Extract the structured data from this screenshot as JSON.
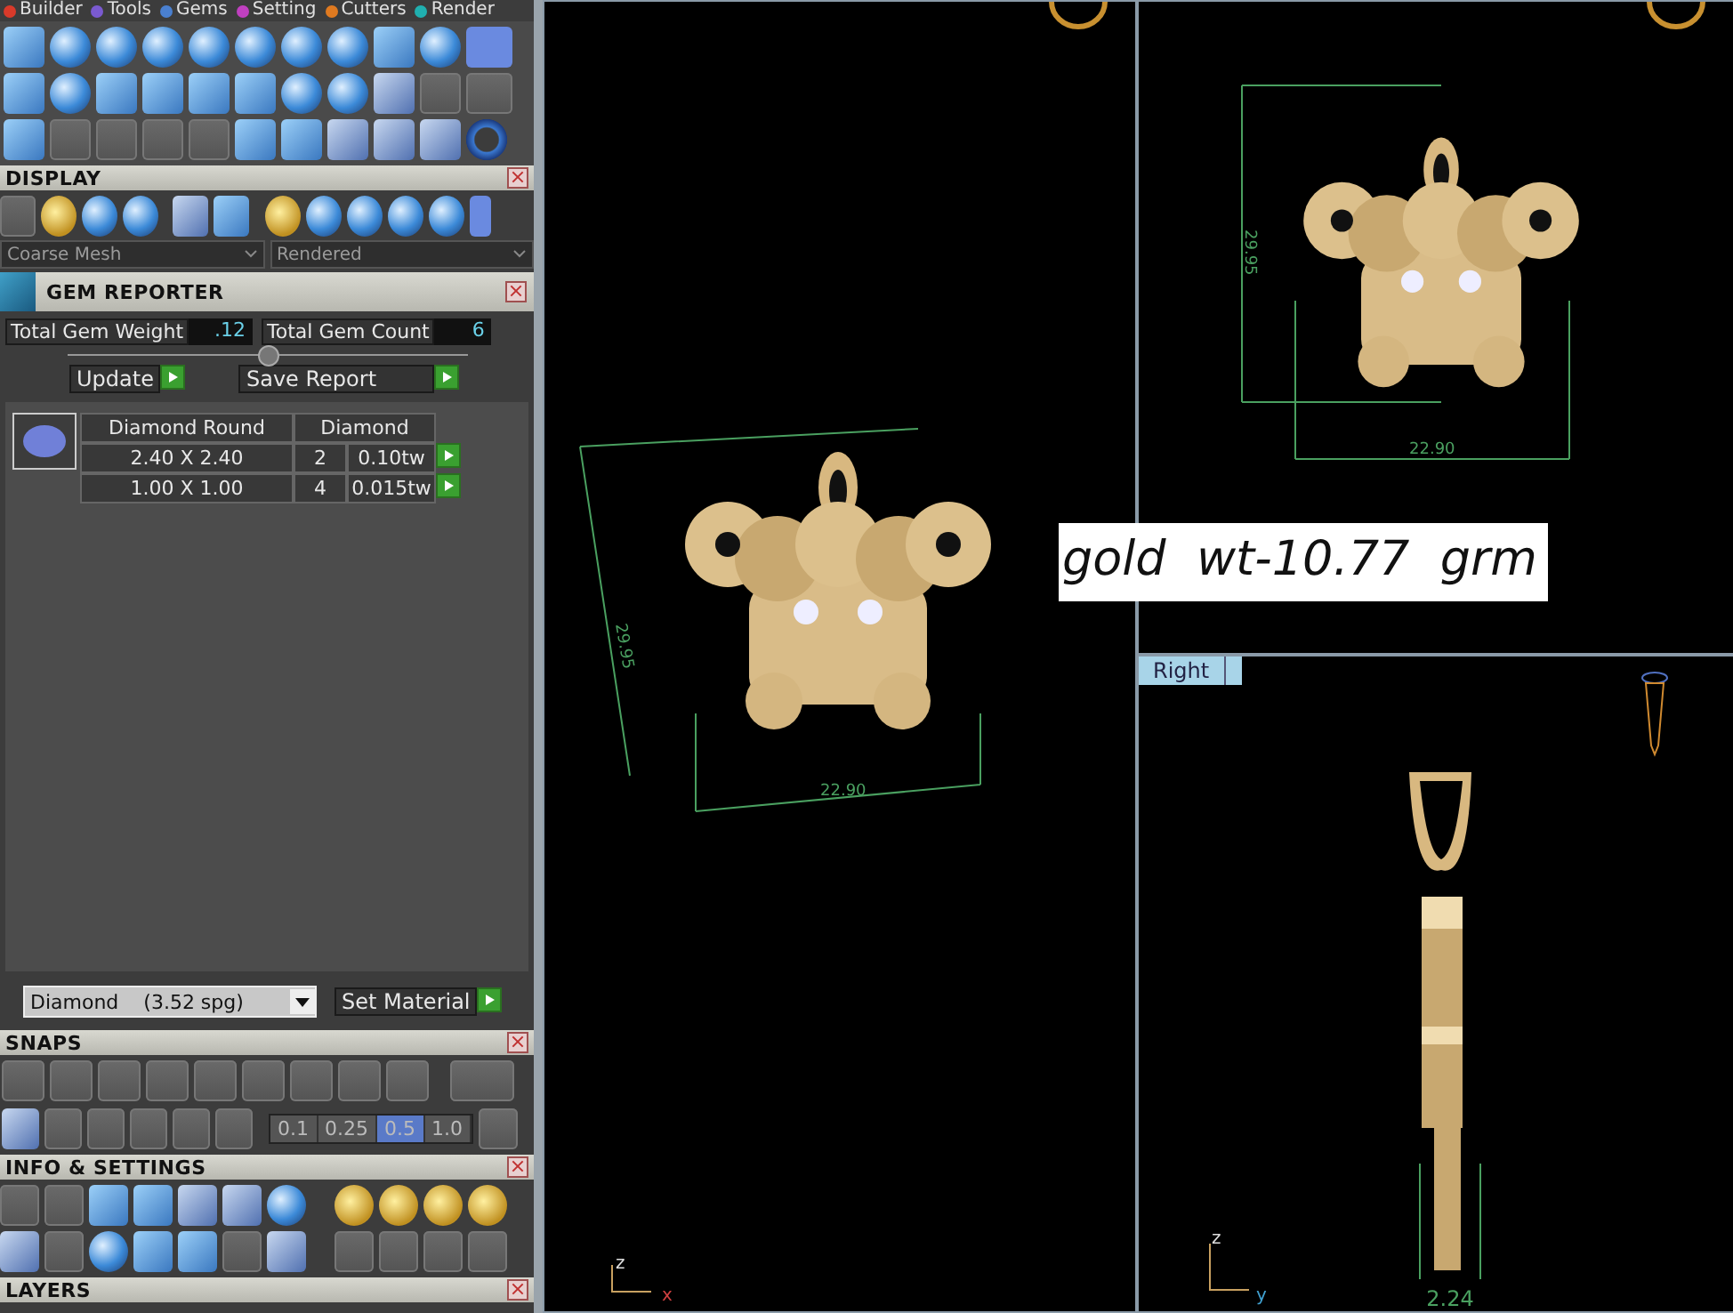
{
  "menu_tabs": [
    {
      "label": "Builder",
      "color": "#d83a2a"
    },
    {
      "label": "Tools",
      "color": "#7a5ad0"
    },
    {
      "label": "Gems",
      "color": "#4a80d0"
    },
    {
      "label": "Setting",
      "color": "#c040c0"
    },
    {
      "label": "Cutters",
      "color": "#e07a20"
    },
    {
      "label": "Render",
      "color": "#20b0b0"
    }
  ],
  "display": {
    "title": "DISPLAY",
    "mesh_select": "Coarse Mesh",
    "render_select": "Rendered"
  },
  "gem_reporter": {
    "title": "GEM REPORTER",
    "total_weight_label": "Total Gem Weight",
    "total_weight": ".12",
    "total_count_label": "Total Gem Count",
    "total_count": "6",
    "buttons": [
      "Update",
      "Save Report"
    ],
    "table": {
      "columns": [
        "Diamond Round",
        "Diamond"
      ],
      "rows": [
        {
          "size": "2.40 X 2.40",
          "count": "2",
          "weight": "0.10tw"
        },
        {
          "size": "1.00 X 1.00",
          "count": "4",
          "weight": "0.015tw"
        }
      ]
    },
    "material": "Diamond    (3.52 spg)",
    "set_material": "Set Material"
  },
  "snaps": {
    "title": "SNAPS",
    "increments": [
      {
        "label": "0.1",
        "selected": false
      },
      {
        "label": "0.25",
        "selected": false
      },
      {
        "label": "0.5",
        "selected": true
      },
      {
        "label": "1.0",
        "selected": false
      }
    ]
  },
  "info": {
    "title": "INFO & SETTINGS"
  },
  "layers": {
    "title": "LAYERS"
  },
  "viewports": {
    "perspective": {
      "height_dim": "29.95",
      "width_dim": "22.90",
      "axes": [
        "z",
        "x"
      ]
    },
    "front": {
      "height_dim": "29.95",
      "width_dim": "22.90"
    },
    "right": {
      "label": "Right",
      "depth_dim": "2.24",
      "axes": [
        "z",
        "y"
      ]
    }
  },
  "annotation": "gold  wt-10.77  grm"
}
